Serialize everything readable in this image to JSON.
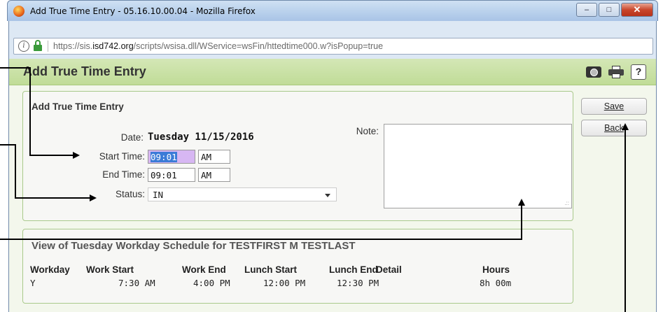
{
  "window": {
    "title": "Add True Time Entry - 05.16.10.00.04 - Mozilla Firefox",
    "minimize_glyph": "–",
    "maximize_glyph": "□",
    "close_glyph": "✕"
  },
  "address": {
    "url_prefix": "https://sis.",
    "url_domain": "isd742.org",
    "url_path": "/scripts/wsisa.dll/WService=wsFin/httedtime000.w?isPopup=true"
  },
  "header": {
    "title": "Add True Time Entry",
    "help_label": "?"
  },
  "entry": {
    "panel_title": "Add True Time Entry",
    "date_label": "Date:",
    "date_value": "Tuesday 11/15/2016",
    "start_label": "Start Time:",
    "start_time": "09:01",
    "start_ampm": "AM",
    "end_label": "End Time:",
    "end_time": "09:01",
    "end_ampm": "AM",
    "status_label": "Status:",
    "status_value": "IN",
    "note_label": "Note:",
    "note_value": ""
  },
  "actions": {
    "save_label": "Save",
    "back_label": "Back"
  },
  "schedule": {
    "title": "View of Tuesday Workday Schedule for TESTFIRST M TESTLAST",
    "headers": [
      "Workday",
      "Work Start",
      "Work End",
      "Lunch Start",
      "Lunch End",
      "Detail",
      "Hours"
    ],
    "row": [
      "Y",
      "7:30 AM",
      "4:00 PM",
      "12:00 PM",
      "12:30 PM",
      "",
      "8h 00m"
    ]
  },
  "colors": {
    "header_green": "#c0dc97",
    "panel_border": "#a9c98b",
    "selection_blue": "#3b7bd7",
    "selection_lilac": "#d7b7f3"
  }
}
